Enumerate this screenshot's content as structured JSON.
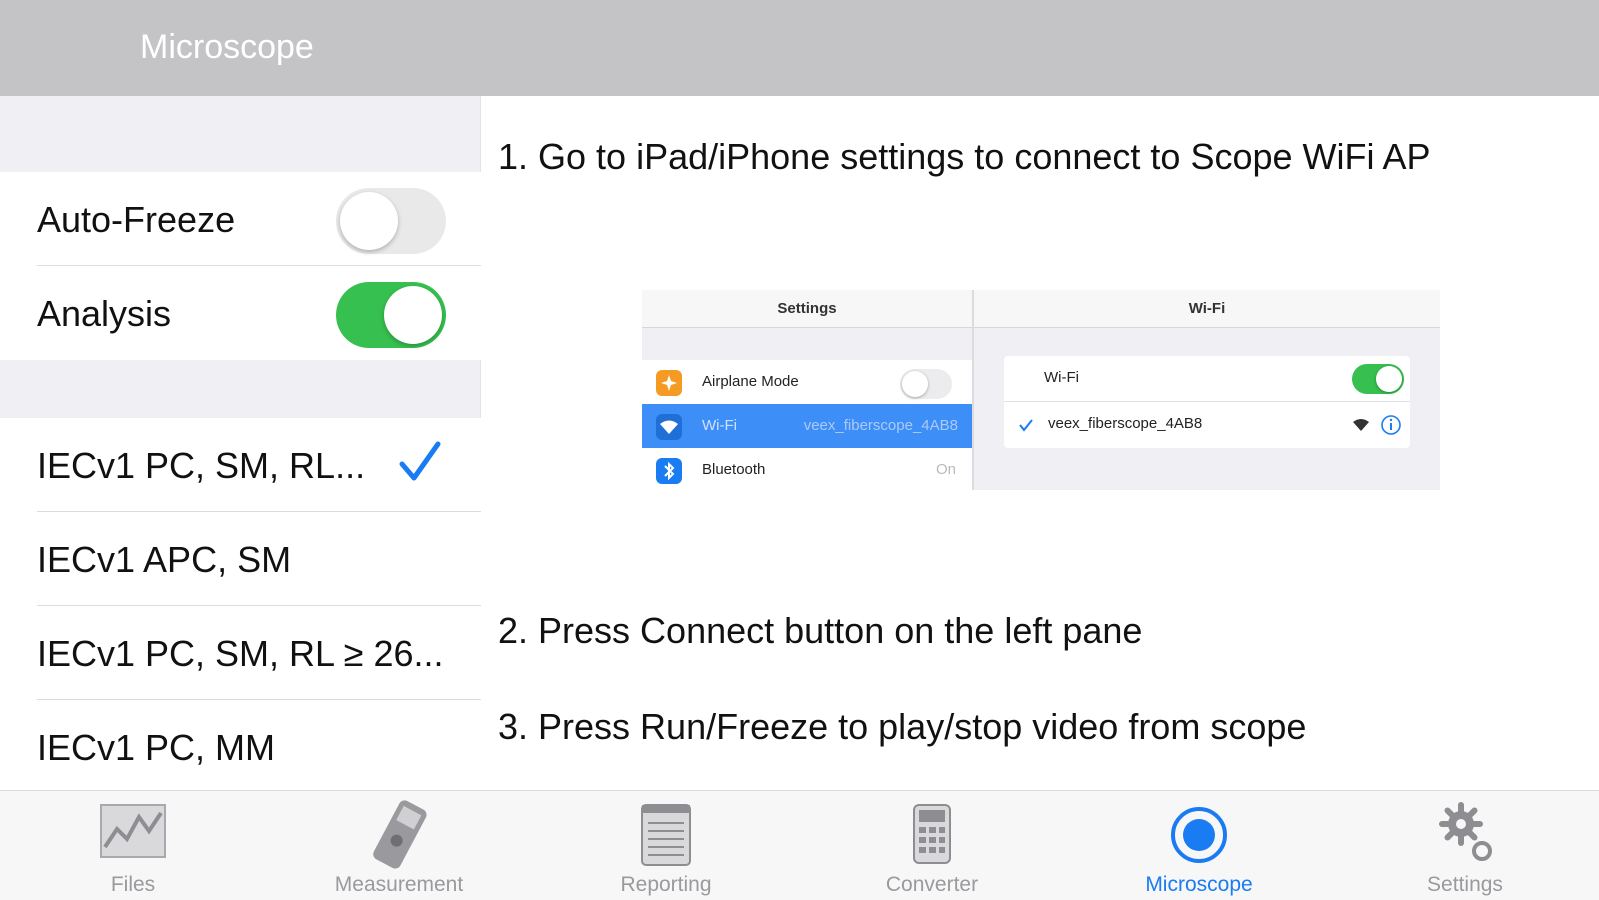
{
  "header": {
    "title": "Microscope"
  },
  "left_pane": {
    "toggles": [
      {
        "label": "Auto-Freeze",
        "state": "off"
      },
      {
        "label": "Analysis",
        "state": "on"
      }
    ],
    "profiles": [
      {
        "label": "IECv1 PC, SM, RL...",
        "selected": true
      },
      {
        "label": "IECv1 APC, SM",
        "selected": false
      },
      {
        "label": "IECv1 PC, SM, RL ≥ 26...",
        "selected": false
      },
      {
        "label": "IECv1 PC, MM",
        "selected": false
      }
    ]
  },
  "instructions": {
    "step1": "1. Go to iPad/iPhone settings to connect to Scope WiFi AP",
    "step2": "2. Press Connect button on the left pane",
    "step3": "3. Press Run/Freeze to play/stop video from scope"
  },
  "illustration": {
    "settings_title": "Settings",
    "wifi_title": "Wi-Fi",
    "rows": [
      {
        "label": "Airplane Mode",
        "value": "",
        "icon": "airplane-icon",
        "icon_color": "#f59a23"
      },
      {
        "label": "Wi-Fi",
        "value": "veex_fiberscope_4AB8",
        "icon": "wifi-icon",
        "icon_color": "#3e8ef7"
      },
      {
        "label": "Bluetooth",
        "value": "On",
        "icon": "bluetooth-icon",
        "icon_color": "#1a7cf2"
      }
    ],
    "wifi_row_label": "Wi-Fi",
    "network_name": "veex_fiberscope_4AB8"
  },
  "tabbar": {
    "tabs": [
      {
        "label": "Files",
        "icon": "chart-icon",
        "active": false
      },
      {
        "label": "Measurement",
        "icon": "meter-icon",
        "active": false
      },
      {
        "label": "Reporting",
        "icon": "notepad-icon",
        "active": false
      },
      {
        "label": "Converter",
        "icon": "calculator-icon",
        "active": false
      },
      {
        "label": "Microscope",
        "icon": "microscope-icon",
        "active": true
      },
      {
        "label": "Settings",
        "icon": "gear-icon",
        "active": false
      }
    ]
  },
  "colors": {
    "accent": "#1a7cf2",
    "toggle_on": "#36c04f",
    "header_bg": "#c4c4c6"
  }
}
